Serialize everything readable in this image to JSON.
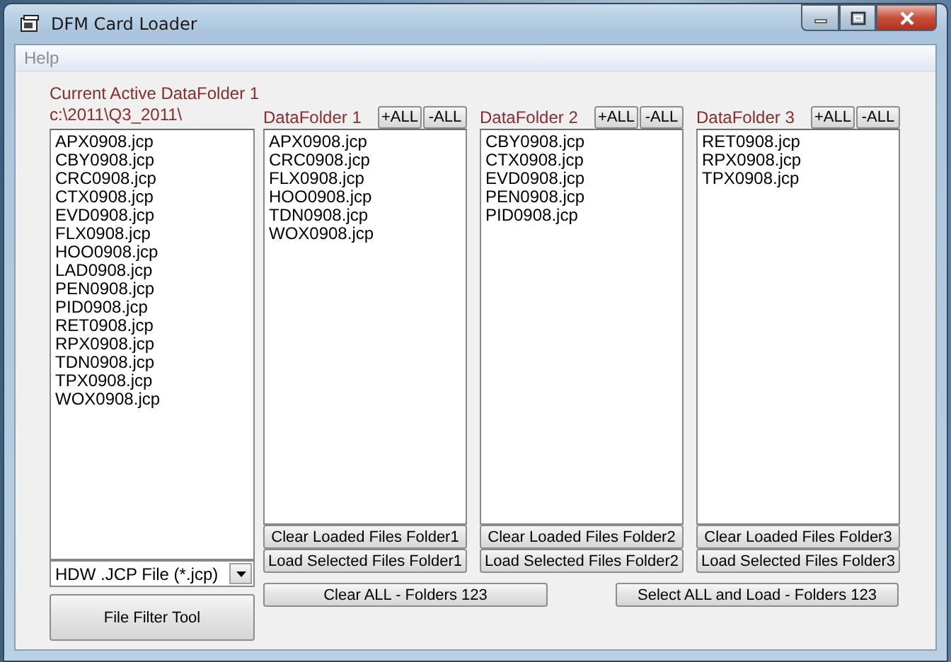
{
  "window": {
    "title": "DFM Card Loader"
  },
  "menu": [
    {
      "label": "Help",
      "disabled": true
    }
  ],
  "active_folder": {
    "label": "Current Active DataFolder 1",
    "path": "c:\\2011\\Q3_2011\\",
    "files": [
      "APX0908.jcp",
      "CBY0908.jcp",
      "CRC0908.jcp",
      "CTX0908.jcp",
      "EVD0908.jcp",
      "FLX0908.jcp",
      "HOO0908.jcp",
      "LAD0908.jcp",
      "PEN0908.jcp",
      "PID0908.jcp",
      "RET0908.jcp",
      "RPX0908.jcp",
      "TDN0908.jcp",
      "TPX0908.jcp",
      "WOX0908.jcp"
    ]
  },
  "file_type": {
    "value": "HDW .JCP File (*.jcp)"
  },
  "filter_button": "File Filter Tool",
  "folders": [
    {
      "label": "DataFolder 1",
      "add_all": "+ALL",
      "remove_all": "-ALL",
      "files": [
        "APX0908.jcp",
        "CRC0908.jcp",
        "FLX0908.jcp",
        "HOO0908.jcp",
        "TDN0908.jcp",
        "WOX0908.jcp"
      ],
      "clear_button": "Clear Loaded Files Folder1",
      "load_button": "Load Selected Files Folder1"
    },
    {
      "label": "DataFolder 2",
      "add_all": "+ALL",
      "remove_all": "-ALL",
      "files": [
        "CBY0908.jcp",
        "CTX0908.jcp",
        "EVD0908.jcp",
        "PEN0908.jcp",
        "PID0908.jcp"
      ],
      "clear_button": "Clear Loaded Files Folder2",
      "load_button": "Load Selected Files Folder2"
    },
    {
      "label": "DataFolder 3",
      "add_all": "+ALL",
      "remove_all": "-ALL",
      "files": [
        "RET0908.jcp",
        "RPX0908.jcp",
        "TPX0908.jcp"
      ],
      "clear_button": "Clear Loaded Files Folder3",
      "load_button": "Load Selected Files Folder3"
    }
  ],
  "bottom_buttons": [
    "Clear ALL - Folders 123",
    "Select ALL and Load - Folders 123"
  ]
}
